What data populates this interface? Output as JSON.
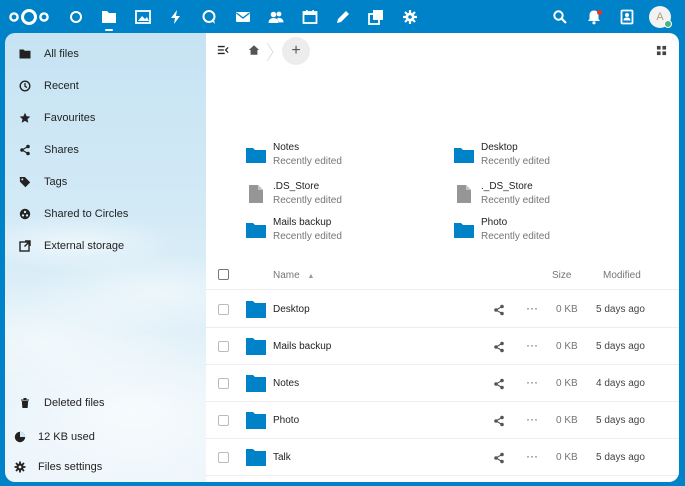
{
  "header": {
    "avatar_initial": "A",
    "apps": [
      {
        "name": "dashboard-icon"
      },
      {
        "name": "files-icon",
        "active": true
      },
      {
        "name": "photos-icon"
      },
      {
        "name": "activity-icon"
      },
      {
        "name": "talk-icon"
      },
      {
        "name": "mail-icon"
      },
      {
        "name": "contacts-icon"
      },
      {
        "name": "calendar-icon"
      },
      {
        "name": "notes-icon"
      },
      {
        "name": "deck-icon"
      },
      {
        "name": "settings-gear-icon"
      }
    ],
    "right_icons": [
      "search-icon",
      "notifications-icon",
      "contacts-menu-icon"
    ]
  },
  "sidebar": {
    "items": [
      {
        "label": "All files",
        "icon": "folder-icon"
      },
      {
        "label": "Recent",
        "icon": "clock-icon"
      },
      {
        "label": "Favourites",
        "icon": "star-icon"
      },
      {
        "label": "Shares",
        "icon": "share-icon"
      },
      {
        "label": "Tags",
        "icon": "tag-icon"
      },
      {
        "label": "Shared to Circles",
        "icon": "circles-icon"
      },
      {
        "label": "External storage",
        "icon": "external-storage-icon"
      }
    ],
    "footer": {
      "deleted": "Deleted files",
      "quota": "12 KB used",
      "settings": "Files settings"
    }
  },
  "main": {
    "new_button": "+",
    "recent": [
      {
        "name": "Notes",
        "sub": "Recently edited",
        "type": "folder"
      },
      {
        "name": "Desktop",
        "sub": "Recently edited",
        "type": "folder"
      },
      {
        "name": ".DS_Store",
        "sub": "Recently edited",
        "type": "file"
      },
      {
        "name": "._DS_Store",
        "sub": "Recently edited",
        "type": "file"
      },
      {
        "name": "Mails backup",
        "sub": "Recently edited",
        "type": "folder"
      },
      {
        "name": "Photo",
        "sub": "Recently edited",
        "type": "folder"
      }
    ],
    "columns": {
      "name": "Name",
      "size": "Size",
      "modified": "Modified"
    },
    "rows": [
      {
        "name": "Desktop",
        "size": "0 KB",
        "modified": "5 days ago"
      },
      {
        "name": "Mails backup",
        "size": "0 KB",
        "modified": "5 days ago"
      },
      {
        "name": "Notes",
        "size": "0 KB",
        "modified": "4 days ago"
      },
      {
        "name": "Photo",
        "size": "0 KB",
        "modified": "5 days ago"
      },
      {
        "name": "Talk",
        "size": "0 KB",
        "modified": "5 days ago"
      }
    ],
    "more_label": "···"
  },
  "colors": {
    "brand": "#0082c9",
    "folder": "#0082c9",
    "file": "#969696"
  }
}
